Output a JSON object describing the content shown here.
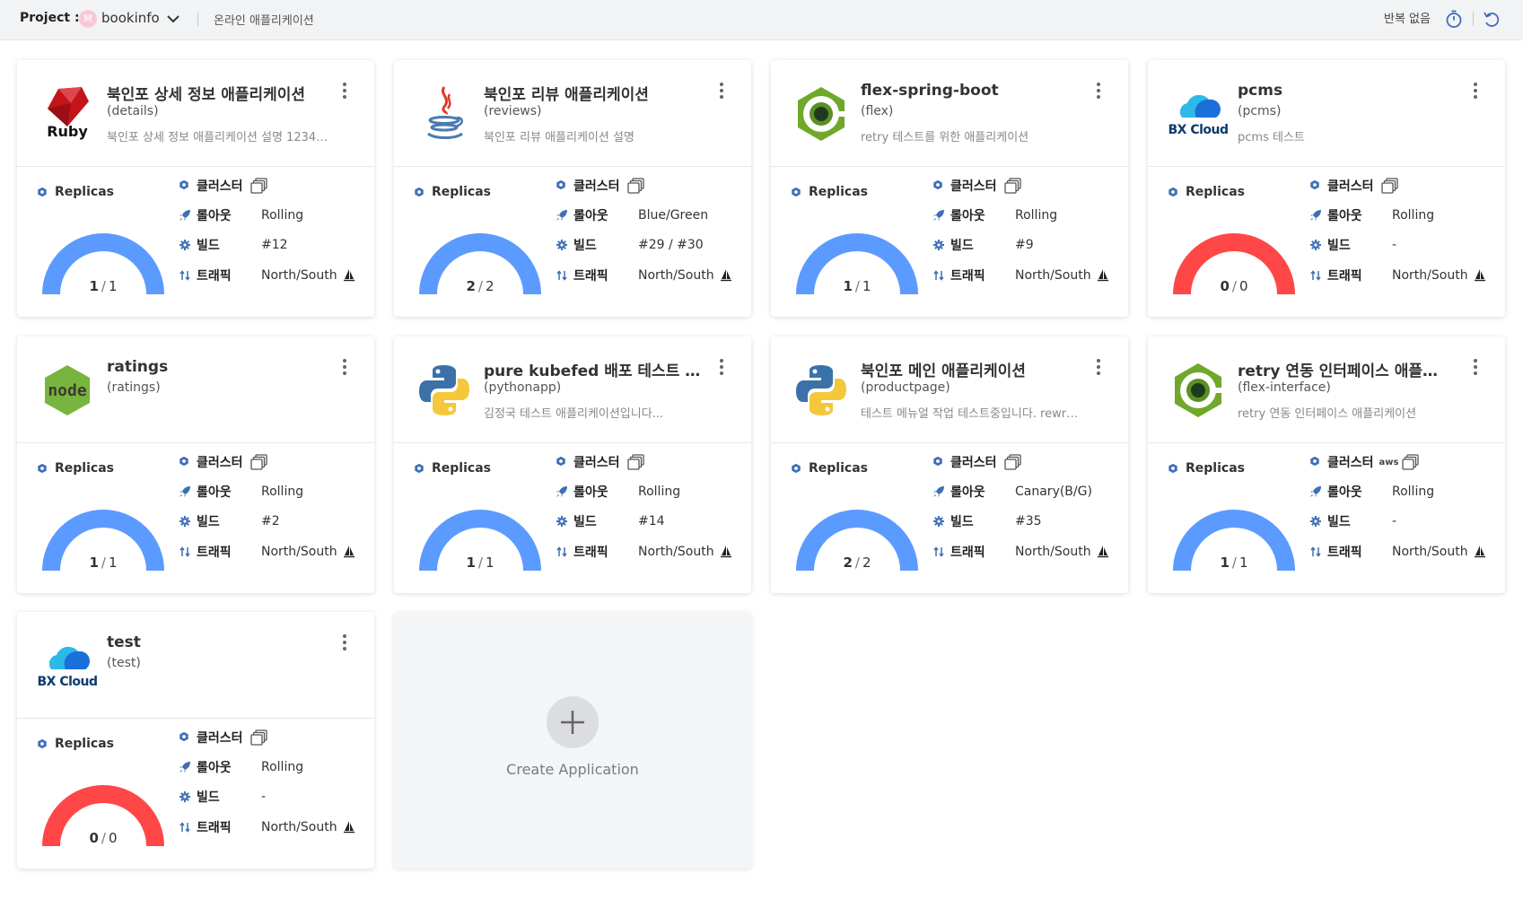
{
  "topbar": {
    "project_label": "Project :",
    "avatar_initial": "M",
    "project_name": "bookinfo",
    "project_desc": "온라인 애플리케이션",
    "repeat_label": "반복 없음"
  },
  "labels": {
    "replicas": "Replicas",
    "cluster": "클러스터",
    "rollout": "롤아웃",
    "build": "빌드",
    "traffic": "트래픽"
  },
  "colors": {
    "gauge_ok": "#5b9bff",
    "gauge_error": "#ff4747",
    "accent_icon": "#3f6fb6"
  },
  "apps": [
    {
      "title": "북인포 상세 정보 애플리케이션",
      "sub": "(details)",
      "desc": "북인포 상세 정보 애플리케이션 설명 1234…",
      "logo": "ruby-logo",
      "logo_text": "Ruby",
      "replicas_ready": "1",
      "replicas_total": "1",
      "replicas_fraction": 1,
      "rollout": "Rolling",
      "build": "#12",
      "traffic": "North/South",
      "aws": ""
    },
    {
      "title": "북인포 리뷰 애플리케이션",
      "sub": "(reviews)",
      "desc": "북인포 리뷰 애플리케이션 설명",
      "logo": "java-logo",
      "logo_text": "",
      "replicas_ready": "2",
      "replicas_total": "2",
      "replicas_fraction": 1,
      "rollout": "Blue/Green",
      "build": "#29 / #30",
      "traffic": "North/South",
      "aws": ""
    },
    {
      "title": "flex-spring-boot",
      "sub": "(flex)",
      "desc": "retry 테스트를 위한 애플리케이션",
      "logo": "flex-logo",
      "logo_text": "",
      "replicas_ready": "1",
      "replicas_total": "1",
      "replicas_fraction": 1,
      "rollout": "Rolling",
      "build": "#9",
      "traffic": "North/South",
      "aws": ""
    },
    {
      "title": "pcms",
      "sub": "(pcms)",
      "desc": "pcms 테스트",
      "logo": "bxcloud-logo",
      "logo_text": "BX Cloud",
      "replicas_ready": "0",
      "replicas_total": "0",
      "replicas_fraction": 0,
      "rollout": "Rolling",
      "build": "-",
      "traffic": "North/South",
      "aws": ""
    },
    {
      "title": "ratings",
      "sub": "(ratings)",
      "desc": "",
      "logo": "node-logo",
      "logo_text": "node",
      "replicas_ready": "1",
      "replicas_total": "1",
      "replicas_fraction": 1,
      "rollout": "Rolling",
      "build": "#2",
      "traffic": "North/South",
      "aws": ""
    },
    {
      "title": "pure kubefed 배포 테스트 …",
      "sub": "(pythonapp)",
      "desc": "김정국 테스트 애플리케이션입니다...",
      "logo": "python-logo",
      "logo_text": "",
      "replicas_ready": "1",
      "replicas_total": "1",
      "replicas_fraction": 1,
      "rollout": "Rolling",
      "build": "#14",
      "traffic": "North/South",
      "aws": ""
    },
    {
      "title": "북인포 메인 애플리케이션",
      "sub": "(productpage)",
      "desc": "테스트 메뉴얼 작업 테스트중입니다. rewr…",
      "logo": "python-logo",
      "logo_text": "",
      "replicas_ready": "2",
      "replicas_total": "2",
      "replicas_fraction": 1,
      "rollout": "Canary(B/G)",
      "build": "#35",
      "traffic": "North/South",
      "aws": ""
    },
    {
      "title": "retry 연동 인터페이스 애플…",
      "sub": "(flex-interface)",
      "desc": "retry 연동 인터페이스 애플리케이션",
      "logo": "flex-logo",
      "logo_text": "",
      "replicas_ready": "1",
      "replicas_total": "1",
      "replicas_fraction": 1,
      "rollout": "Rolling",
      "build": "-",
      "traffic": "North/South",
      "aws": "aws"
    },
    {
      "title": "test",
      "sub": "(test)",
      "desc": "",
      "logo": "bxcloud-logo",
      "logo_text": "BX Cloud",
      "replicas_ready": "0",
      "replicas_total": "0",
      "replicas_fraction": 0,
      "rollout": "Rolling",
      "build": "-",
      "traffic": "North/South",
      "aws": ""
    }
  ],
  "create": {
    "label": "Create Application"
  }
}
